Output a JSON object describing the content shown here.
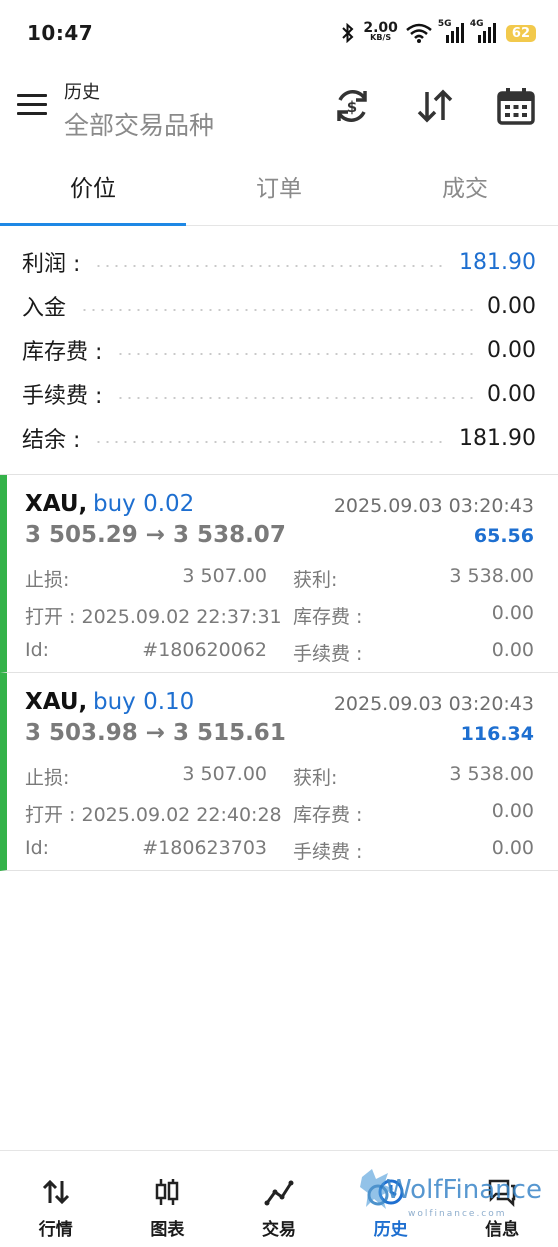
{
  "status_bar": {
    "time": "10:47",
    "net_speed_value": "2.00",
    "net_speed_unit": "KB/S",
    "sim1_label": "5G",
    "sim2_label": "4G",
    "battery": "62"
  },
  "header": {
    "title": "历史",
    "subtitle": "全部交易品种",
    "icons": [
      "currency-exchange-icon",
      "sort-icon",
      "calendar-icon"
    ]
  },
  "tabs": [
    {
      "label": "价位",
      "active": true
    },
    {
      "label": "订单",
      "active": false
    },
    {
      "label": "成交",
      "active": false
    }
  ],
  "summary": [
    {
      "label": "利润 :",
      "value": "181.90"
    },
    {
      "label": "入金",
      "value": "0.00"
    },
    {
      "label": "库存费 :",
      "value": "0.00"
    },
    {
      "label": "手续费 :",
      "value": "0.00"
    },
    {
      "label": "结余 :",
      "value": "181.90"
    }
  ],
  "deals": [
    {
      "symbol": "XAU,",
      "type": "buy 0.02",
      "time": "2025.09.03 03:20:43",
      "prices": "3 505.29 → 3 538.07",
      "profit": "65.56",
      "sl_label": "止损:",
      "sl_value": "3 507.00",
      "tp_label": "获利:",
      "tp_value": "3 538.00",
      "open_label": "打开 : 2025.09.02 22:37:31",
      "swap_label": "库存费 :",
      "swap_value": "0.00",
      "id_label": "Id:",
      "id_value": "#180620062",
      "fee_label": "手续费 :",
      "fee_value": "0.00"
    },
    {
      "symbol": "XAU,",
      "type": "buy 0.10",
      "time": "2025.09.03 03:20:43",
      "prices": "3 503.98 → 3 515.61",
      "profit": "116.34",
      "sl_label": "止损:",
      "sl_value": "3 507.00",
      "tp_label": "获利:",
      "tp_value": "3 538.00",
      "open_label": "打开 : 2025.09.02 22:40:28",
      "swap_label": "库存费 :",
      "swap_value": "0.00",
      "id_label": "Id:",
      "id_value": "#180623703",
      "fee_label": "手续费 :",
      "fee_value": "0.00"
    }
  ],
  "bottom_nav": [
    {
      "label": "行情",
      "icon": "quotes-arrows-icon"
    },
    {
      "label": "图表",
      "icon": "candlestick-icon"
    },
    {
      "label": "交易",
      "icon": "trade-line-icon"
    },
    {
      "label": "历史",
      "icon": "history-icon",
      "active": true
    },
    {
      "label": "信息",
      "icon": "messages-icon"
    }
  ],
  "watermark": {
    "brand": "WolfFinance",
    "url": "wolfinance.com"
  },
  "colors": {
    "accent": "#1e6fd0",
    "profit_bar": "#34b249",
    "battery": "#f2c94c"
  }
}
